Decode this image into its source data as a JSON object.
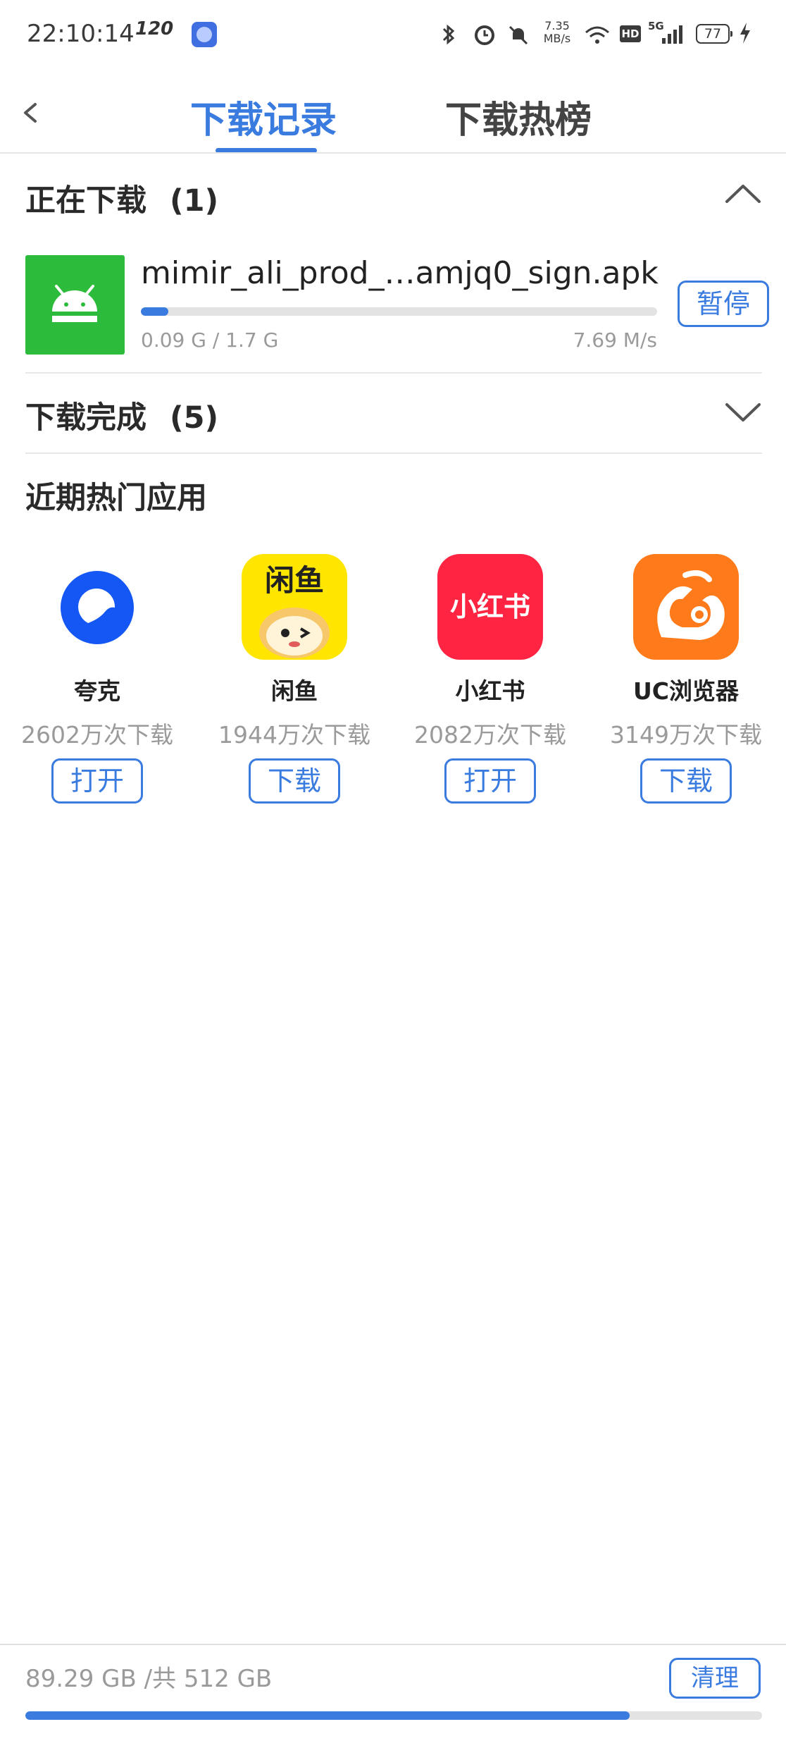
{
  "status_bar": {
    "time": "22:10:14",
    "refresh_rate": "120",
    "net_speed_value": "7.35",
    "net_speed_unit": "MB/s",
    "hd_label": "HD",
    "network_type": "5G",
    "battery": "77",
    "icons": [
      "bluetooth-icon",
      "alarm-icon",
      "mute-icon",
      "wifi-icon",
      "signal-icon",
      "charging-icon"
    ]
  },
  "header": {
    "tabs": [
      {
        "label": "下载记录",
        "active": true
      },
      {
        "label": "下载热榜",
        "active": false
      }
    ]
  },
  "downloading": {
    "title": "正在下载",
    "count": "(1)",
    "item": {
      "file_name": "mimir_ali_prod_…amjq0_sign.apk",
      "size_progress": "0.09 G / 1.7 G",
      "speed": "7.69 M/s",
      "progress": 0.053,
      "action": "暂停"
    }
  },
  "completed": {
    "title": "下载完成",
    "count": "(5)"
  },
  "hot_apps": {
    "title": "近期热门应用",
    "apps": [
      {
        "name": "夸克",
        "downloads": "2602万次下载",
        "action": "打开"
      },
      {
        "name": "闲鱼",
        "downloads": "1944万次下载",
        "action": "下载",
        "icon_text": "闲鱼"
      },
      {
        "name": "小红书",
        "downloads": "2082万次下载",
        "action": "打开",
        "icon_text": "小红书"
      },
      {
        "name": "UC浏览器",
        "downloads": "3149万次下载",
        "action": "下载"
      }
    ]
  },
  "storage": {
    "text": "89.29 GB /共 512 GB",
    "action": "清理",
    "used_fraction": 0.82
  },
  "colors": {
    "accent": "#3a7be0",
    "apk_green": "#2dbb3c",
    "quark_blue": "#1457f5",
    "xianyu_yellow": "#ffe600",
    "xiaohongshu_red": "#ff2442",
    "uc_orange": "#ff7a1a"
  }
}
